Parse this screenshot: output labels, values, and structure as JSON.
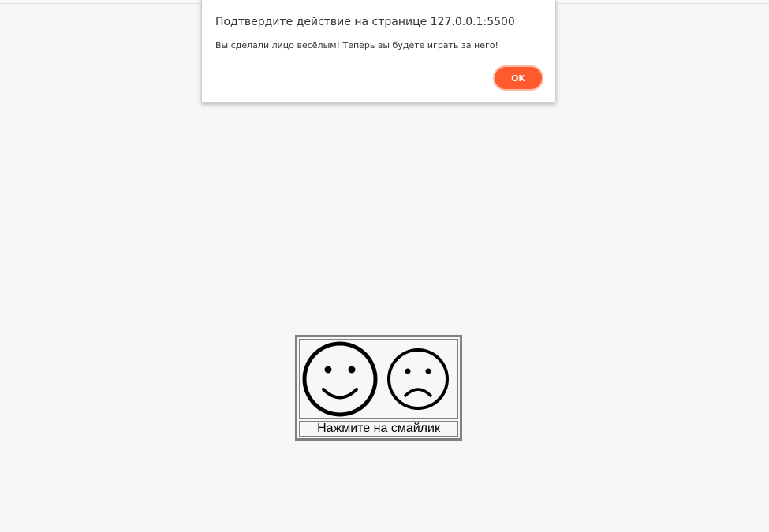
{
  "dialog": {
    "title": "Подтвердите действие на странице 127.0.0.1:5500",
    "message": "Вы сделали лицо весёлым! Теперь вы будете играть за него!",
    "ok_label": "OK"
  },
  "smiley_table": {
    "faces": [
      {
        "icon": "happy-face-icon"
      },
      {
        "icon": "sad-face-icon"
      }
    ],
    "caption": "Нажмите на смайлик"
  },
  "colors": {
    "background": "#f7f7f7",
    "ok_button": "#ff5a2e",
    "table_border": "#808080"
  }
}
